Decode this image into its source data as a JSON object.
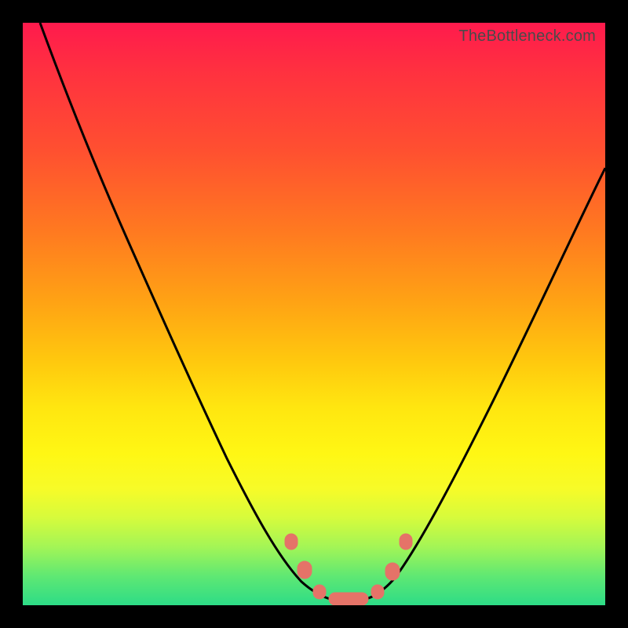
{
  "watermark": "TheBottleneck.com",
  "colors": {
    "frame": "#000000",
    "curve_stroke": "#000000",
    "marker_fill": "#e57368",
    "marker_stroke": "#e57368",
    "gradient_top": "#ff1a4d",
    "gradient_bottom": "#2ddc87"
  },
  "chart_data": {
    "type": "line",
    "title": "",
    "xlabel": "",
    "ylabel": "",
    "xlim": [
      0,
      100
    ],
    "ylim": [
      0,
      100
    ],
    "note": "Axes are implicit (no tick labels shown). x ≈ horizontal position left→right, y ≈ vertical position bottom→top, both normalized 0–100 from visual estimation.",
    "series": [
      {
        "name": "bottleneck-curve",
        "x": [
          3,
          10,
          18,
          26,
          33,
          39,
          44,
          48,
          51,
          54,
          57,
          60,
          63,
          67,
          72,
          79,
          88,
          100
        ],
        "y": [
          100,
          84,
          67,
          50,
          35,
          23,
          14,
          7,
          3,
          1,
          1,
          2,
          5,
          12,
          24,
          40,
          60,
          82
        ]
      }
    ],
    "markers": [
      {
        "x": 46,
        "y": 11
      },
      {
        "x": 48,
        "y": 6
      },
      {
        "x": 51,
        "y": 2
      },
      {
        "x": 54,
        "y": 1
      },
      {
        "x": 57,
        "y": 1
      },
      {
        "x": 60,
        "y": 2
      },
      {
        "x": 63,
        "y": 6
      },
      {
        "x": 65,
        "y": 11
      }
    ]
  }
}
